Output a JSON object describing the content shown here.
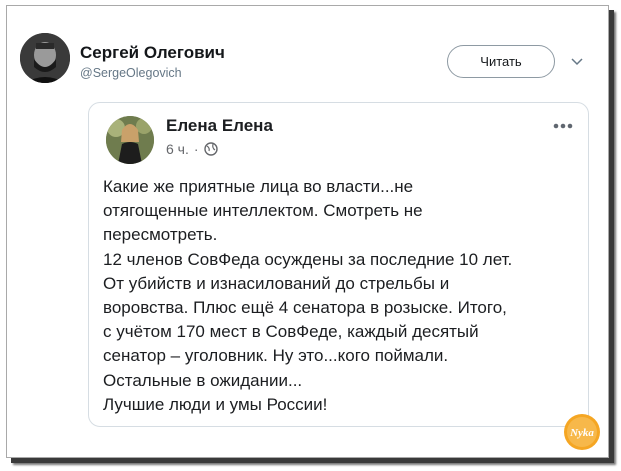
{
  "tweet": {
    "author_name": "Сергей Олегович",
    "author_handle": "@SergeOlegovich",
    "follow_label": "Читать"
  },
  "embedded_post": {
    "author_name": "Елена Елена",
    "time": "6 ч.",
    "separator": "·",
    "text_lines": [
      "Какие же приятные лица во власти...не",
      "отягощенные интеллектом. Смотреть не",
      "пересмотреть.",
      "12 членов СовФеда осуждены за последние 10 лет.",
      "От убийств и изнасилований до стрельбы и",
      "воровства. Плюс ещё 4 сенатора в розыске. Итого,",
      "с учётом 170 мест в СовФеде, каждый десятый",
      "сенатор – уголовник. Ну это...кого поймали.",
      "Остальные в ожидании...",
      "Лучшие люди и умы России!"
    ]
  },
  "watermark": {
    "logo_text": "Nyka"
  },
  "colors": {
    "primary_text": "#14171a",
    "secondary_text": "#657786",
    "card_border": "#d6dde3",
    "logo_orange": "#f5a623"
  },
  "icons": {
    "chevron": "chevron-down-icon",
    "globe": "globe-icon",
    "more": "more-horizontal-icon"
  }
}
